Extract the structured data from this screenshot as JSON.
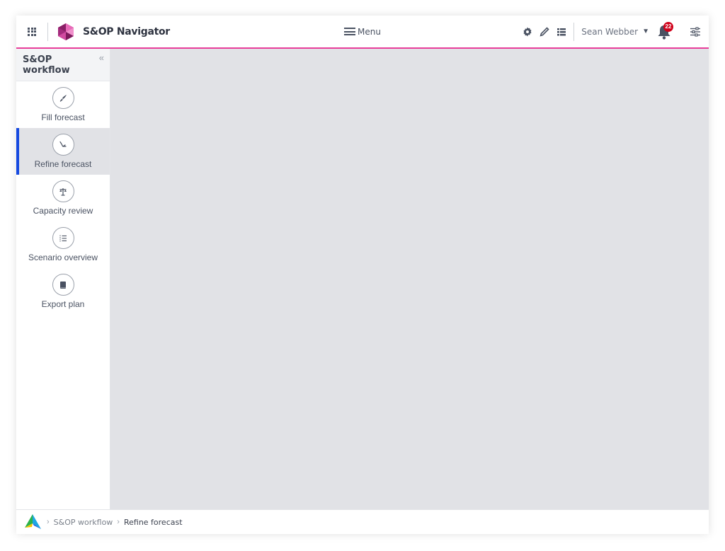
{
  "header": {
    "app_title": "S&OP Navigator",
    "menu_label": "Menu",
    "user_name": "Sean Webber",
    "notification_count": "22",
    "accent_color": "#e83e9a"
  },
  "sidebar": {
    "title_line1": "S&OP",
    "title_line2": "workflow",
    "collapse_glyph": "«",
    "active_color": "#1549e0",
    "steps": [
      {
        "label": "Fill forecast",
        "icon": "brush-icon",
        "active": false
      },
      {
        "label": "Refine forecast",
        "icon": "pipette-icon",
        "active": true
      },
      {
        "label": "Capacity review",
        "icon": "balance-scale-icon",
        "active": false
      },
      {
        "label": "Scenario overview",
        "icon": "ordered-list-icon",
        "active": false
      },
      {
        "label": "Export plan",
        "icon": "book-icon",
        "active": false
      }
    ]
  },
  "breadcrumb": {
    "separator": "›",
    "items": [
      "S&OP workflow",
      "Refine forecast"
    ]
  }
}
